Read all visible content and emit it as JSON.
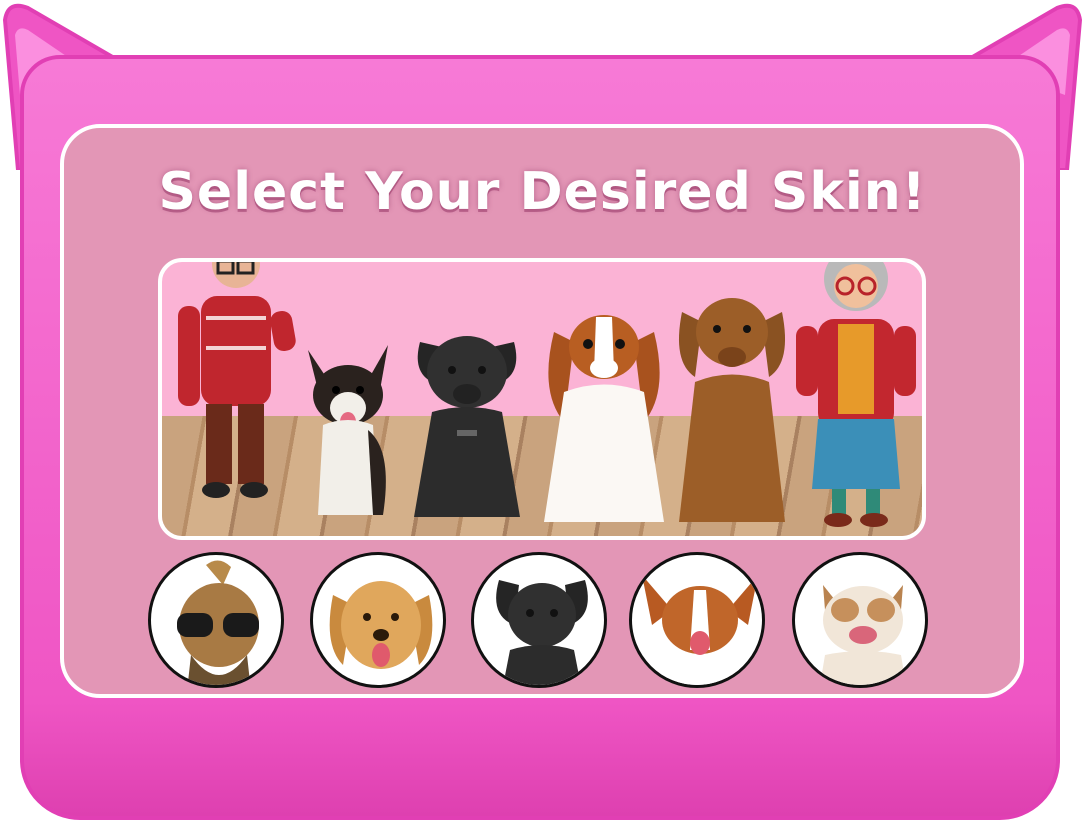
{
  "title": "Select Your Desired Skin!",
  "colors": {
    "frame": "#f062c8",
    "panel": "#e396b6",
    "stage_bg": "#fbb3d5",
    "title_text": "#ffffff"
  },
  "characters": [
    {
      "name": "old-man-red-sweater"
    },
    {
      "name": "tricolor-corgi-dog"
    },
    {
      "name": "black-puppy"
    },
    {
      "name": "cavalier-king-charles-spaniel"
    },
    {
      "name": "brown-retriever-dog"
    },
    {
      "name": "grandma-red-cardigan"
    }
  ],
  "skin_options": [
    {
      "name": "yorkshire-terrier-sunglasses"
    },
    {
      "name": "golden-retriever-puppy"
    },
    {
      "name": "black-puppy"
    },
    {
      "name": "papillon-mix-dog"
    },
    {
      "name": "english-bulldog"
    }
  ]
}
